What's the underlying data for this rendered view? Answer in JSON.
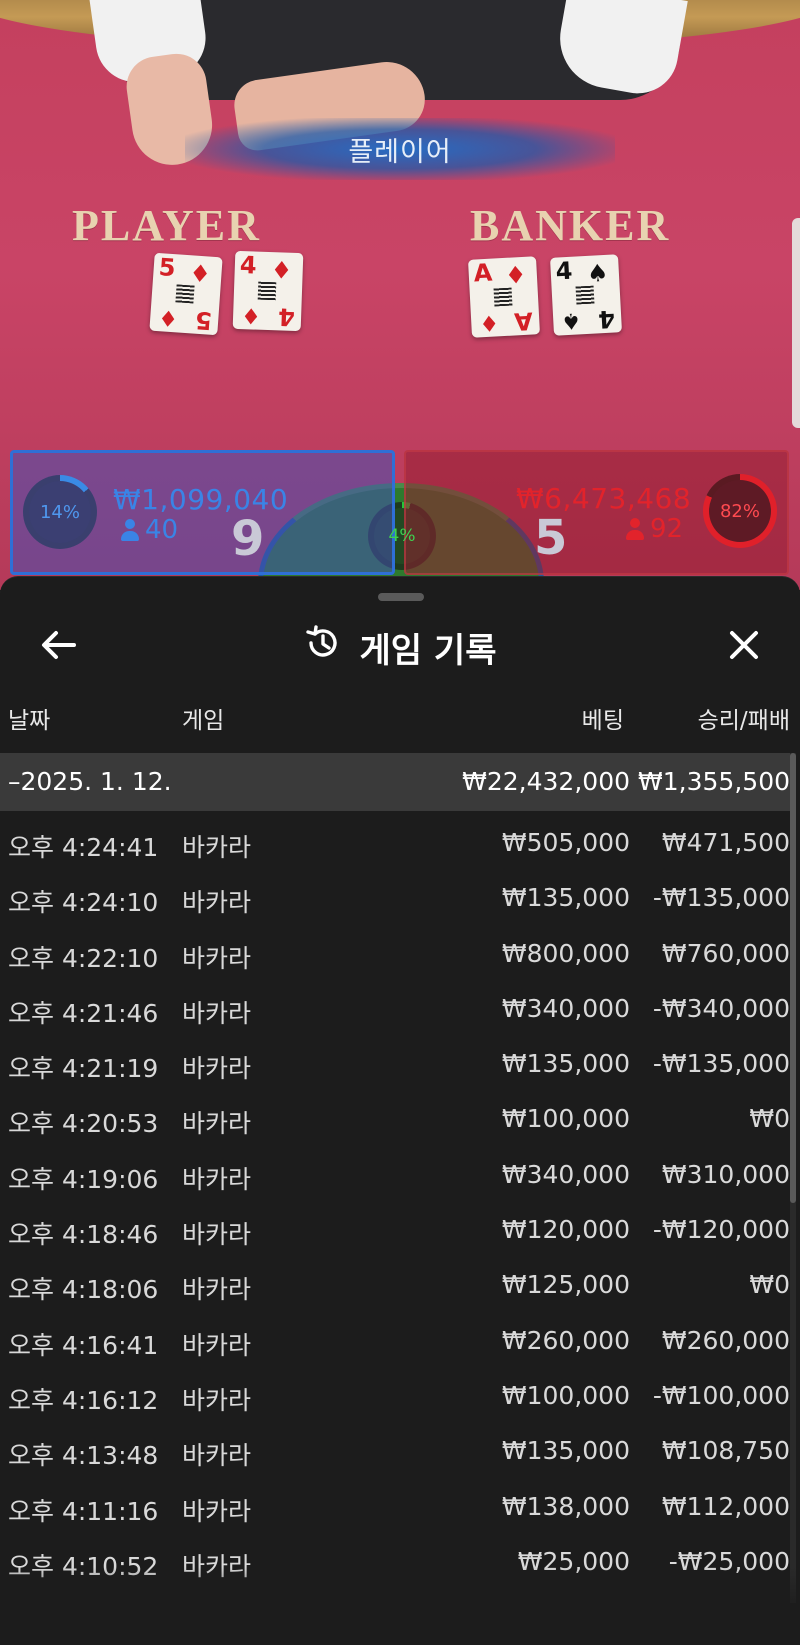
{
  "game_view": {
    "result_banner": "플레이어",
    "player_label": "PLAYER",
    "banker_label": "BANKER",
    "player_cards": [
      {
        "rank": "5",
        "suit": "♦",
        "color": "red"
      },
      {
        "rank": "4",
        "suit": "♦",
        "color": "red"
      }
    ],
    "banker_cards": [
      {
        "rank": "A",
        "suit": "♦",
        "color": "red"
      },
      {
        "rank": "4",
        "suit": "♠",
        "color": "black"
      }
    ]
  },
  "bets": {
    "player": {
      "percent": "14%",
      "amount": "₩1,099,040",
      "players": "40",
      "score": "9",
      "color": "#3a84e6"
    },
    "tie": {
      "percent": "4%",
      "color": "#27c43a"
    },
    "banker": {
      "percent": "82%",
      "amount": "₩6,473,468",
      "players": "92",
      "score": "5",
      "color": "#e2232b"
    }
  },
  "sheet": {
    "title": "게임 기록",
    "icons": {
      "back": "arrow-left-icon",
      "title": "history-icon",
      "close": "close-icon"
    },
    "columns": {
      "date": "날짜",
      "game": "게임",
      "bet": "베팅",
      "result": "승리/패배"
    },
    "date_group": {
      "label": "–2025. 1. 12.",
      "bet": "₩22,432,000",
      "result": "₩1,355,500"
    },
    "rows": [
      {
        "time": "오후 4:24:41",
        "game": "바카라",
        "bet": "₩505,000",
        "result": "₩471,500"
      },
      {
        "time": "오후 4:24:10",
        "game": "바카라",
        "bet": "₩135,000",
        "result": "-₩135,000"
      },
      {
        "time": "오후 4:22:10",
        "game": "바카라",
        "bet": "₩800,000",
        "result": "₩760,000"
      },
      {
        "time": "오후 4:21:46",
        "game": "바카라",
        "bet": "₩340,000",
        "result": "-₩340,000"
      },
      {
        "time": "오후 4:21:19",
        "game": "바카라",
        "bet": "₩135,000",
        "result": "-₩135,000"
      },
      {
        "time": "오후 4:20:53",
        "game": "바카라",
        "bet": "₩100,000",
        "result": "₩0"
      },
      {
        "time": "오후 4:19:06",
        "game": "바카라",
        "bet": "₩340,000",
        "result": "₩310,000"
      },
      {
        "time": "오후 4:18:46",
        "game": "바카라",
        "bet": "₩120,000",
        "result": "-₩120,000"
      },
      {
        "time": "오후 4:18:06",
        "game": "바카라",
        "bet": "₩125,000",
        "result": "₩0"
      },
      {
        "time": "오후 4:16:41",
        "game": "바카라",
        "bet": "₩260,000",
        "result": "₩260,000"
      },
      {
        "time": "오후 4:16:12",
        "game": "바카라",
        "bet": "₩100,000",
        "result": "-₩100,000"
      },
      {
        "time": "오후 4:13:48",
        "game": "바카라",
        "bet": "₩135,000",
        "result": "₩108,750"
      },
      {
        "time": "오후 4:11:16",
        "game": "바카라",
        "bet": "₩138,000",
        "result": "₩112,000"
      },
      {
        "time": "오후 4:10:52",
        "game": "바카라",
        "bet": "₩25,000",
        "result": "-₩25,000"
      }
    ]
  }
}
